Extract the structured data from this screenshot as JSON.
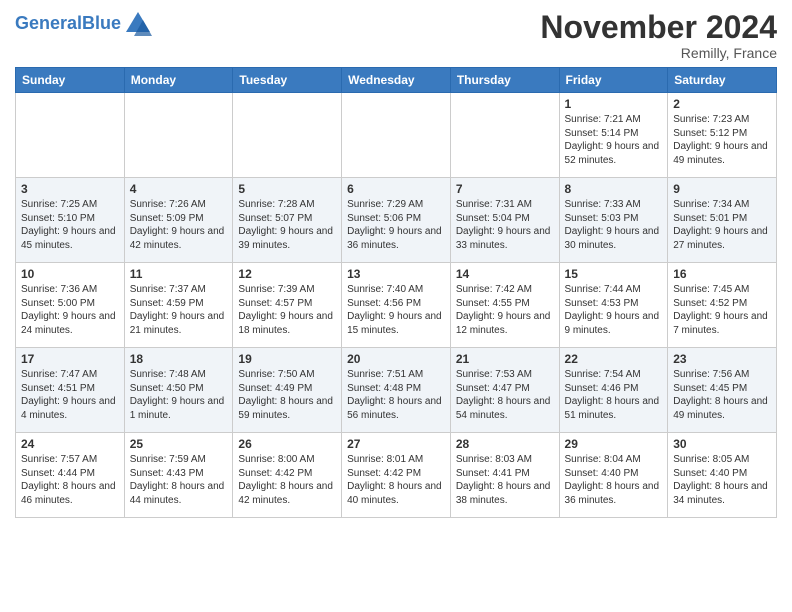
{
  "header": {
    "logo_general": "General",
    "logo_blue": "Blue",
    "month_title": "November 2024",
    "location": "Remilly, France"
  },
  "weekdays": [
    "Sunday",
    "Monday",
    "Tuesday",
    "Wednesday",
    "Thursday",
    "Friday",
    "Saturday"
  ],
  "weeks": [
    [
      {
        "day": "",
        "info": ""
      },
      {
        "day": "",
        "info": ""
      },
      {
        "day": "",
        "info": ""
      },
      {
        "day": "",
        "info": ""
      },
      {
        "day": "",
        "info": ""
      },
      {
        "day": "1",
        "info": "Sunrise: 7:21 AM\nSunset: 5:14 PM\nDaylight: 9 hours and 52 minutes."
      },
      {
        "day": "2",
        "info": "Sunrise: 7:23 AM\nSunset: 5:12 PM\nDaylight: 9 hours and 49 minutes."
      }
    ],
    [
      {
        "day": "3",
        "info": "Sunrise: 7:25 AM\nSunset: 5:10 PM\nDaylight: 9 hours and 45 minutes."
      },
      {
        "day": "4",
        "info": "Sunrise: 7:26 AM\nSunset: 5:09 PM\nDaylight: 9 hours and 42 minutes."
      },
      {
        "day": "5",
        "info": "Sunrise: 7:28 AM\nSunset: 5:07 PM\nDaylight: 9 hours and 39 minutes."
      },
      {
        "day": "6",
        "info": "Sunrise: 7:29 AM\nSunset: 5:06 PM\nDaylight: 9 hours and 36 minutes."
      },
      {
        "day": "7",
        "info": "Sunrise: 7:31 AM\nSunset: 5:04 PM\nDaylight: 9 hours and 33 minutes."
      },
      {
        "day": "8",
        "info": "Sunrise: 7:33 AM\nSunset: 5:03 PM\nDaylight: 9 hours and 30 minutes."
      },
      {
        "day": "9",
        "info": "Sunrise: 7:34 AM\nSunset: 5:01 PM\nDaylight: 9 hours and 27 minutes."
      }
    ],
    [
      {
        "day": "10",
        "info": "Sunrise: 7:36 AM\nSunset: 5:00 PM\nDaylight: 9 hours and 24 minutes."
      },
      {
        "day": "11",
        "info": "Sunrise: 7:37 AM\nSunset: 4:59 PM\nDaylight: 9 hours and 21 minutes."
      },
      {
        "day": "12",
        "info": "Sunrise: 7:39 AM\nSunset: 4:57 PM\nDaylight: 9 hours and 18 minutes."
      },
      {
        "day": "13",
        "info": "Sunrise: 7:40 AM\nSunset: 4:56 PM\nDaylight: 9 hours and 15 minutes."
      },
      {
        "day": "14",
        "info": "Sunrise: 7:42 AM\nSunset: 4:55 PM\nDaylight: 9 hours and 12 minutes."
      },
      {
        "day": "15",
        "info": "Sunrise: 7:44 AM\nSunset: 4:53 PM\nDaylight: 9 hours and 9 minutes."
      },
      {
        "day": "16",
        "info": "Sunrise: 7:45 AM\nSunset: 4:52 PM\nDaylight: 9 hours and 7 minutes."
      }
    ],
    [
      {
        "day": "17",
        "info": "Sunrise: 7:47 AM\nSunset: 4:51 PM\nDaylight: 9 hours and 4 minutes."
      },
      {
        "day": "18",
        "info": "Sunrise: 7:48 AM\nSunset: 4:50 PM\nDaylight: 9 hours and 1 minute."
      },
      {
        "day": "19",
        "info": "Sunrise: 7:50 AM\nSunset: 4:49 PM\nDaylight: 8 hours and 59 minutes."
      },
      {
        "day": "20",
        "info": "Sunrise: 7:51 AM\nSunset: 4:48 PM\nDaylight: 8 hours and 56 minutes."
      },
      {
        "day": "21",
        "info": "Sunrise: 7:53 AM\nSunset: 4:47 PM\nDaylight: 8 hours and 54 minutes."
      },
      {
        "day": "22",
        "info": "Sunrise: 7:54 AM\nSunset: 4:46 PM\nDaylight: 8 hours and 51 minutes."
      },
      {
        "day": "23",
        "info": "Sunrise: 7:56 AM\nSunset: 4:45 PM\nDaylight: 8 hours and 49 minutes."
      }
    ],
    [
      {
        "day": "24",
        "info": "Sunrise: 7:57 AM\nSunset: 4:44 PM\nDaylight: 8 hours and 46 minutes."
      },
      {
        "day": "25",
        "info": "Sunrise: 7:59 AM\nSunset: 4:43 PM\nDaylight: 8 hours and 44 minutes."
      },
      {
        "day": "26",
        "info": "Sunrise: 8:00 AM\nSunset: 4:42 PM\nDaylight: 8 hours and 42 minutes."
      },
      {
        "day": "27",
        "info": "Sunrise: 8:01 AM\nSunset: 4:42 PM\nDaylight: 8 hours and 40 minutes."
      },
      {
        "day": "28",
        "info": "Sunrise: 8:03 AM\nSunset: 4:41 PM\nDaylight: 8 hours and 38 minutes."
      },
      {
        "day": "29",
        "info": "Sunrise: 8:04 AM\nSunset: 4:40 PM\nDaylight: 8 hours and 36 minutes."
      },
      {
        "day": "30",
        "info": "Sunrise: 8:05 AM\nSunset: 4:40 PM\nDaylight: 8 hours and 34 minutes."
      }
    ]
  ]
}
